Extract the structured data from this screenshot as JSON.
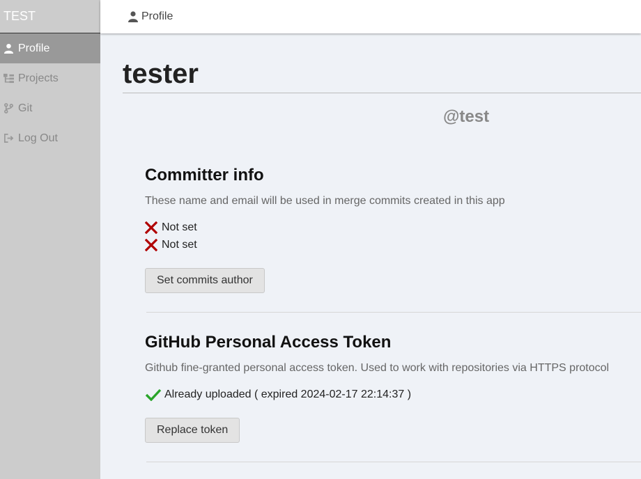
{
  "app": {
    "brand": "TEST"
  },
  "sidebar": {
    "items": [
      {
        "label": "Profile",
        "icon": "user-icon",
        "active": true
      },
      {
        "label": "Projects",
        "icon": "projects-icon",
        "active": false
      },
      {
        "label": "Git",
        "icon": "git-branch-icon",
        "active": false
      },
      {
        "label": "Log Out",
        "icon": "logout-icon",
        "active": false
      }
    ]
  },
  "topbar": {
    "breadcrumb": "Profile",
    "icon": "user-icon"
  },
  "profile": {
    "name": "tester",
    "handle": "@test"
  },
  "committer": {
    "title": "Committer info",
    "description": "These name and email will be used in merge commits created in this app",
    "name_status": "Not set",
    "email_status": "Not set",
    "button": "Set commits author"
  },
  "token": {
    "title": "GitHub Personal Access Token",
    "description": "Github fine-granted personal access token. Used to work with repositories via HTTPS protocol",
    "status": "Already uploaded ( expired 2024-02-17 22:14:37 )",
    "button": "Replace token"
  },
  "colors": {
    "sidebar_bg": "#cccccc",
    "active_bg": "#999999",
    "error": "#b00000",
    "success": "#2aa52a",
    "page_bg": "#eff2f7"
  }
}
